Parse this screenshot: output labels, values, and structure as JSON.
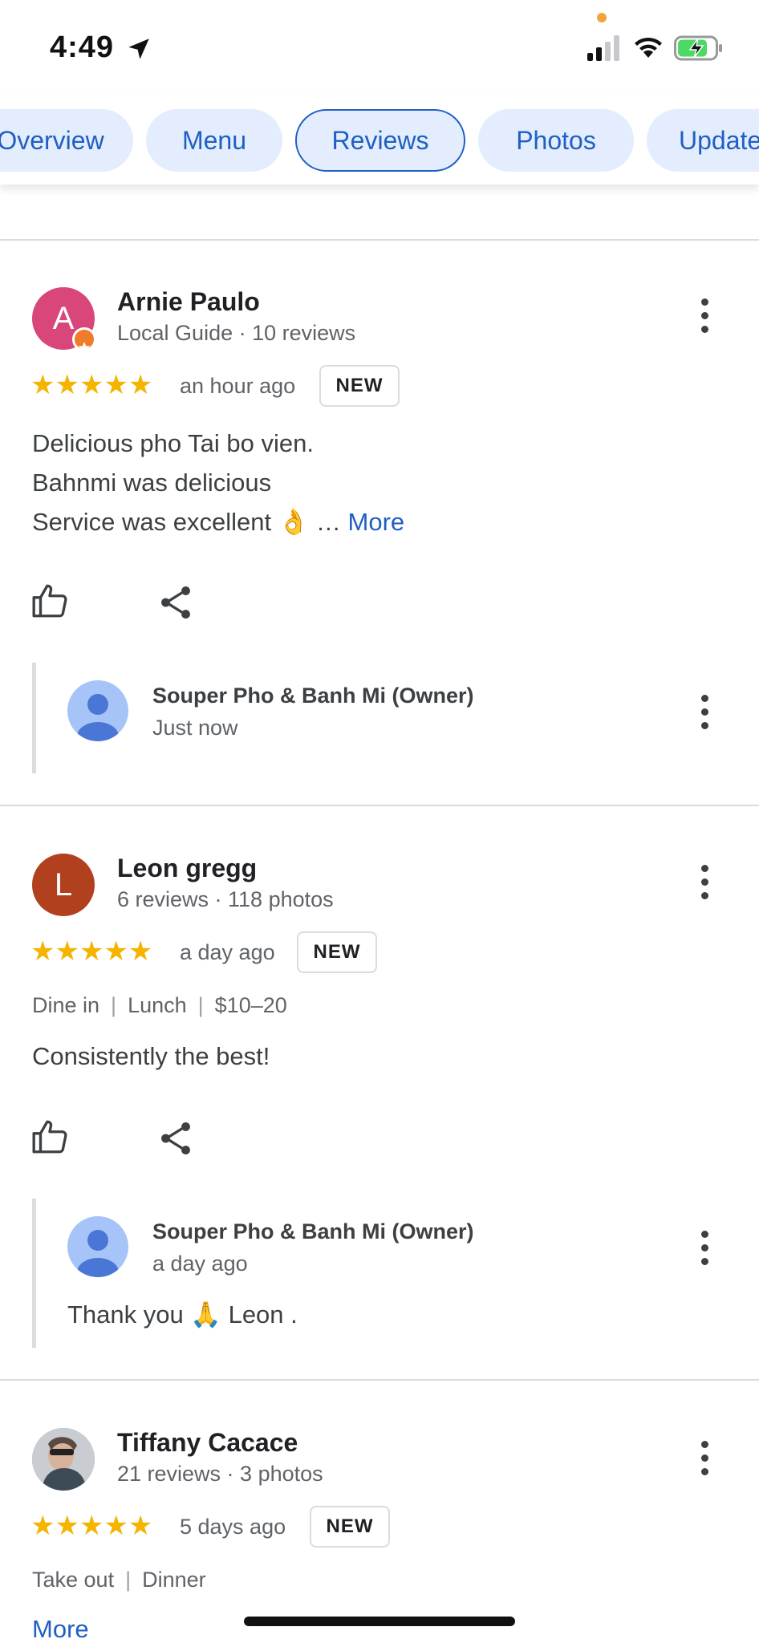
{
  "status_bar": {
    "time": "4:49",
    "icons": [
      "location-arrow-icon",
      "signal-icon",
      "wifi-icon",
      "battery-charging-icon"
    ]
  },
  "tabs": [
    {
      "label": "Overview"
    },
    {
      "label": "Menu"
    },
    {
      "label": "Reviews",
      "active": true
    },
    {
      "label": "Photos"
    },
    {
      "label": "Updates"
    }
  ],
  "reviews": [
    {
      "author": "Arnie Paulo",
      "avatar_letter": "A",
      "meta": "Local Guide · 10 reviews",
      "rating": 5,
      "stars": "★★★★★",
      "when": "an hour ago",
      "badge": "NEW",
      "text_lines": [
        "Delicious pho Tai bo vien.",
        "Bahnmi was delicious",
        "Service was excellent 👌 …"
      ],
      "more": "More",
      "owner_reply": {
        "name": "Souper Pho & Banh Mi (Owner)",
        "when": "Just now"
      }
    },
    {
      "author": "Leon gregg",
      "avatar_letter": "L",
      "meta": "6 reviews · 118 photos",
      "rating": 5,
      "stars": "★★★★★",
      "when": "a day ago",
      "badge": "NEW",
      "tags": [
        "Dine in",
        "Lunch",
        "$10–20"
      ],
      "text": "Consistently the best!",
      "owner_reply": {
        "name": "Souper Pho & Banh Mi (Owner)",
        "when": "a day ago",
        "text": "Thank you 🙏 Leon ."
      }
    },
    {
      "author": "Tiffany Cacace",
      "meta": "21 reviews · 3 photos",
      "rating": 5,
      "stars": "★★★★★",
      "when": "5 days ago",
      "badge": "NEW",
      "tags": [
        "Take out",
        "Dinner"
      ],
      "more": "More"
    }
  ],
  "colors": {
    "accent": "#1f5fc4",
    "star": "#f4b400",
    "tab_bg": "#e3edfd"
  }
}
